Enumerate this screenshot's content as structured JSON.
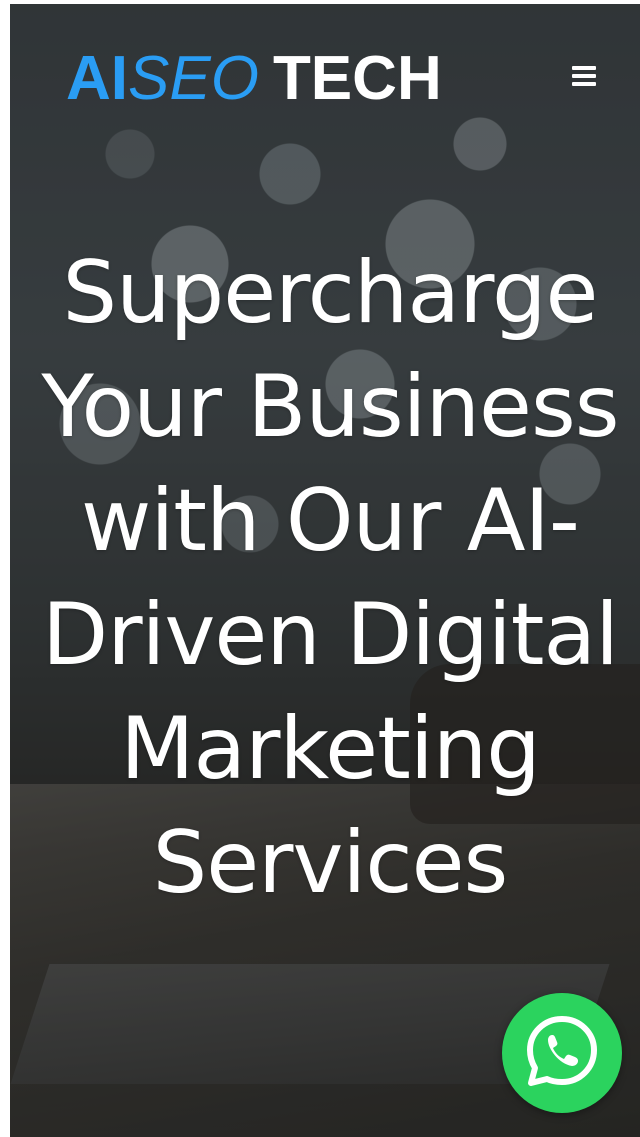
{
  "brand": {
    "logo_part_ai": "AI",
    "logo_part_seo": "SEO",
    "logo_part_tech": "TECH",
    "accent_color": "#2a9df4"
  },
  "header": {
    "menu_icon": "hamburger-menu-icon"
  },
  "hero": {
    "headline": "Supercharge Your Business with Our AI-Driven Digital Marketing Services"
  },
  "floating_actions": {
    "whatsapp_icon": "whatsapp-icon",
    "whatsapp_color": "#2bd35e"
  }
}
